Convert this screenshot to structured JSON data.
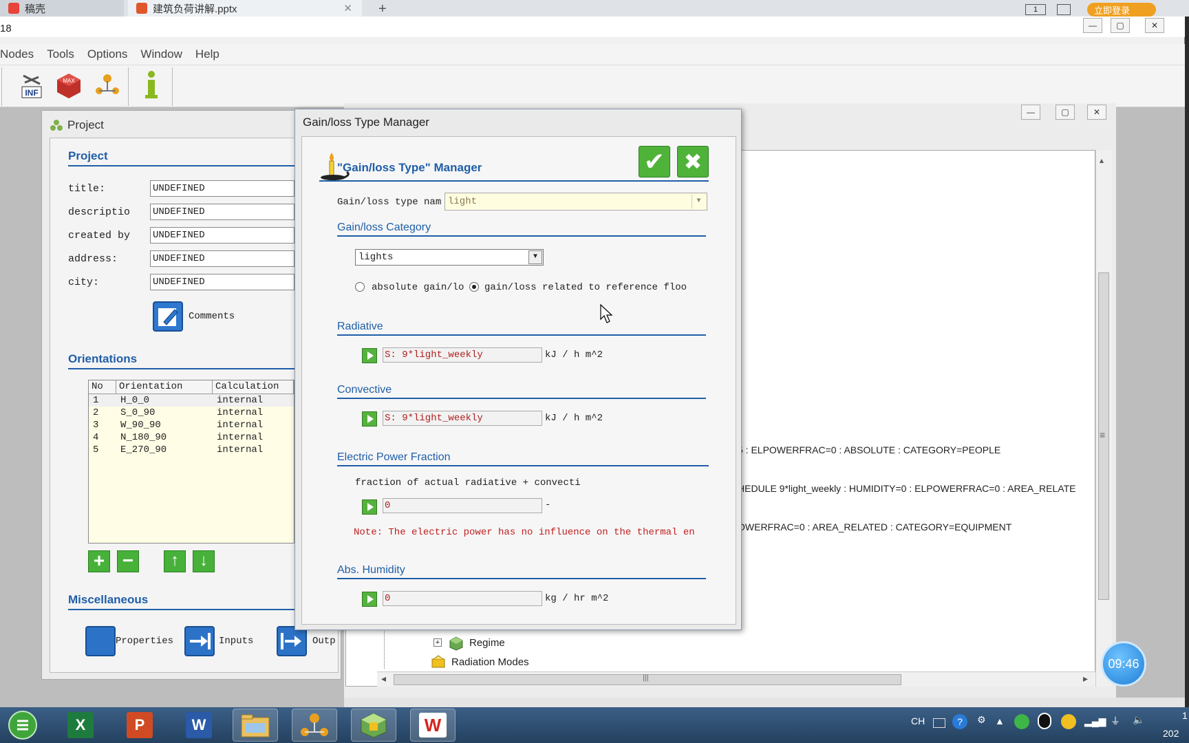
{
  "browser": {
    "tab1_label": "稿壳",
    "tab2_label": "建筑负荷讲解.pptx",
    "tab2_close": "✕",
    "new_tab": "+",
    "login_label": "立即登录",
    "icon1_label": "1"
  },
  "app": {
    "title_fragment": "18",
    "win_buttons": [
      "—",
      "▢",
      "✕"
    ],
    "menu": [
      "Nodes",
      "Tools",
      "Options",
      "Window",
      "Help"
    ],
    "toolbar": {
      "inf_label": "INF",
      "max_label": "MAX"
    }
  },
  "project_window": {
    "title": "Project",
    "section_project": "Project",
    "fields": [
      {
        "label": "title:",
        "value": "UNDEFINED"
      },
      {
        "label": "descriptio",
        "value": "UNDEFINED"
      },
      {
        "label": "created by",
        "value": "UNDEFINED"
      },
      {
        "label": "address:",
        "value": "UNDEFINED"
      },
      {
        "label": "city:",
        "value": "UNDEFINED"
      }
    ],
    "comments_label": "Comments",
    "section_orientations": "Orientations",
    "table_headers": [
      "No",
      "Orientation",
      "Calculation"
    ],
    "orientations": [
      {
        "no": "1",
        "name": "H_0_0",
        "calc": "internal"
      },
      {
        "no": "2",
        "name": "S_0_90",
        "calc": "internal"
      },
      {
        "no": "3",
        "name": "W_90_90",
        "calc": "internal"
      },
      {
        "no": "4",
        "name": "N_180_90",
        "calc": "internal"
      },
      {
        "no": "5",
        "name": "E_270_90",
        "calc": "internal"
      }
    ],
    "btn_add": "+",
    "btn_remove": "−",
    "btn_up": "↑",
    "btn_down": "↓",
    "section_misc": "Miscellaneous",
    "properties_label": "Properties",
    "inputs_label": "Inputs",
    "outputs_label": "Outp"
  },
  "background_window": {
    "lines": [
      "5 : ELPOWERFRAC=0 :  ABSOLUTE : CATEGORY=PEOPLE",
      "HEDULE 9*light_weekly : HUMIDITY=0 : ELPOWERFRAC=0 :  AREA_RELATE",
      "OWERFRAC=0 :  AREA_RELATED : CATEGORY=EQUIPMENT"
    ],
    "tree_regime": "Regime",
    "tree_radiation": "Radiation Modes",
    "tree_expand": "+",
    "hscroll_grip": "|||",
    "vscroll_grip": "≡",
    "scroll_left": "◂",
    "scroll_right": "▸",
    "scroll_up": "▴"
  },
  "dialog": {
    "title": "Gain/loss Type Manager",
    "header": "\"Gain/loss Type\" Manager",
    "ok_icon": "✔",
    "cancel_icon": "✖",
    "type_name_label": "Gain/loss type nam",
    "type_name_value": "light",
    "section_category": "Gain/loss Category",
    "category_value": "lights",
    "radio_absolute": "absolute gain/lo",
    "radio_related": "gain/loss related to reference floo",
    "section_radiative": "Radiative",
    "radiative_value": "S: 9*light_weekly",
    "radiative_unit": "kJ / h m^2",
    "section_convective": "Convective",
    "convective_value": "S: 9*light_weekly",
    "convective_unit": "kJ / h m^2",
    "section_electric": "Electric Power Fraction",
    "electric_desc": "fraction of actual radiative + convecti",
    "electric_value": "0",
    "electric_unit": "-",
    "electric_note": "Note: The electric power has no influence on the  thermal en",
    "section_humidity": "Abs. Humidity",
    "humidity_value": "0",
    "humidity_unit": "kg / hr m^2"
  },
  "clock_time": "09:46",
  "taskbar": {
    "excel_label": "X",
    "ppt_label": "P",
    "word_label": "W",
    "wps_label": "W",
    "tray_lang": "CH",
    "tray_help": "?",
    "time_fragment": "1",
    "date_fragment": "202"
  }
}
